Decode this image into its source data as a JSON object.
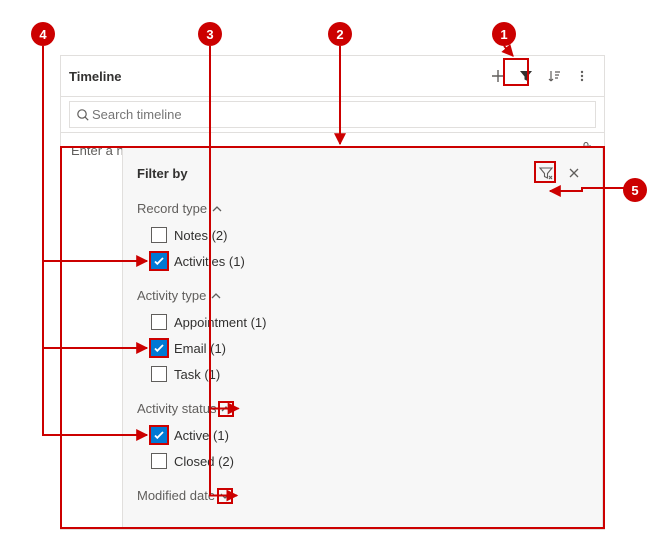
{
  "header": {
    "title": "Timeline"
  },
  "search": {
    "placeholder": "Search timeline"
  },
  "note": {
    "placeholder": "Enter a note..."
  },
  "filter": {
    "title": "Filter by",
    "sections": [
      {
        "label": "Record type",
        "expanded": true,
        "options": [
          {
            "label": "Notes (2)",
            "checked": false
          },
          {
            "label": "Activities (1)",
            "checked": true
          }
        ]
      },
      {
        "label": "Activity type",
        "expanded": true,
        "options": [
          {
            "label": "Appointment (1)",
            "checked": false
          },
          {
            "label": "Email (1)",
            "checked": true
          },
          {
            "label": "Task (1)",
            "checked": false
          }
        ]
      },
      {
        "label": "Activity status",
        "expanded": true,
        "options": [
          {
            "label": "Active (1)",
            "checked": true
          },
          {
            "label": "Closed (2)",
            "checked": false
          }
        ]
      },
      {
        "label": "Modified date",
        "expanded": false,
        "options": []
      }
    ]
  },
  "callouts": [
    "1",
    "2",
    "3",
    "4",
    "5"
  ]
}
